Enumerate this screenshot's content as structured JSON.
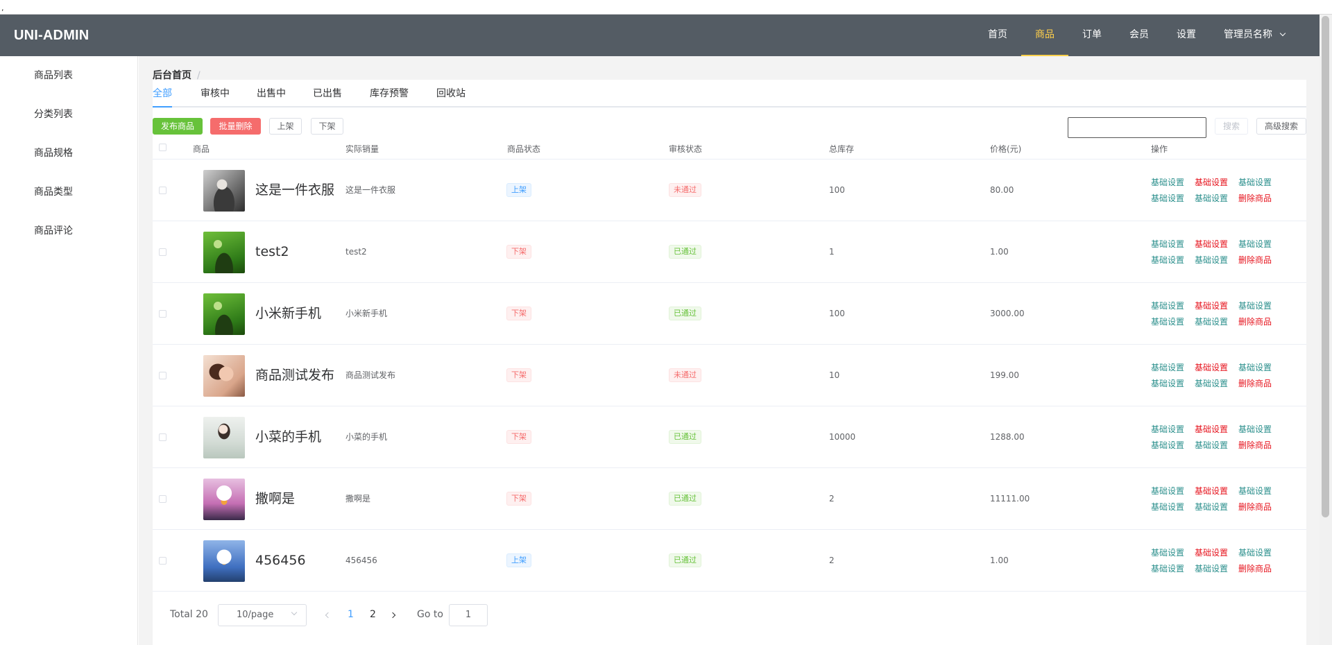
{
  "stray_mark": ",",
  "header": {
    "logo": "UNI-ADMIN",
    "nav": [
      "首页",
      "商品",
      "订单",
      "会员",
      "设置"
    ],
    "active_nav": "商品",
    "user": "管理员名称"
  },
  "sidebar": {
    "items": [
      "商品列表",
      "分类列表",
      "商品规格",
      "商品类型",
      "商品评论"
    ]
  },
  "breadcrumb": {
    "home": "后台首页",
    "sep": "/"
  },
  "tabs": [
    "全部",
    "审核中",
    "出售中",
    "已出售",
    "库存预警",
    "回收站"
  ],
  "toolbar": {
    "publish": "发布商品",
    "batch_delete": "批量删除",
    "on_shelf": "上架",
    "off_shelf": "下架",
    "search_placeholder": "",
    "search": "搜索",
    "advanced_search": "高级搜索"
  },
  "table": {
    "columns": [
      "商品",
      "实际销量",
      "商品状态",
      "审核状态",
      "总库存",
      "价格(元)",
      "操作"
    ],
    "rows": [
      {
        "name": "这是一件衣服",
        "sales": "这是一件衣服",
        "status": "上架",
        "audit": "未通过",
        "stock": "100",
        "price": "80.00",
        "thumb": "girl-dark"
      },
      {
        "name": "test2",
        "sales": "test2",
        "status": "下架",
        "audit": "已通过",
        "stock": "1",
        "price": "1.00",
        "thumb": "green-plant"
      },
      {
        "name": "小米新手机",
        "sales": "小米新手机",
        "status": "下架",
        "audit": "已通过",
        "stock": "100",
        "price": "3000.00",
        "thumb": "green-plant"
      },
      {
        "name": "商品测试发布",
        "sales": "商品测试发布",
        "status": "下架",
        "audit": "未通过",
        "stock": "10",
        "price": "199.00",
        "thumb": "girl-warm"
      },
      {
        "name": "小菜的手机",
        "sales": "小菜的手机",
        "status": "下架",
        "audit": "已通过",
        "stock": "10000",
        "price": "1288.00",
        "thumb": "girl-light"
      },
      {
        "name": "撒啊是",
        "sales": "撒啊是",
        "status": "下架",
        "audit": "已通过",
        "stock": "2",
        "price": "11111.00",
        "thumb": "duck-pink"
      },
      {
        "name": "456456",
        "sales": "456456",
        "status": "上架",
        "audit": "已通过",
        "stock": "2",
        "price": "1.00",
        "thumb": "duck-blue"
      }
    ],
    "actions": {
      "row1": [
        "基础设置",
        "基础设置",
        "基础设置"
      ],
      "row2": [
        "基础设置",
        "基础设置",
        "删除商品"
      ]
    }
  },
  "pagination": {
    "total": "Total 20",
    "page_size": "10/page",
    "pages": [
      "1",
      "2"
    ],
    "current_page": "1",
    "goto_label": "Go to",
    "goto_value": "1"
  },
  "colors": {
    "header_bg": "#545c64",
    "active_nav": "#ffd04b",
    "primary": "#409eff",
    "success": "#67c23a",
    "danger": "#f56c6c",
    "action_teal": "#2b8f8c",
    "action_red": "#e6141e"
  }
}
